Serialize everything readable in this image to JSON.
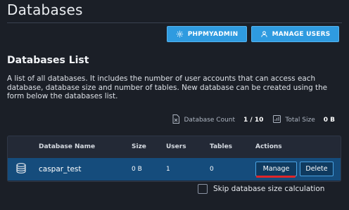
{
  "header": {
    "title": "Databases",
    "buttons": {
      "phpmyadmin_label": "PHPMYADMIN",
      "phpmyadmin_icon": "gear-icon",
      "manage_users_label": "MANAGE USERS",
      "manage_users_icon": "user-icon"
    }
  },
  "section": {
    "title": "Databases List",
    "description": "A list of all databases. It includes the number of user accounts that can access each database, database size and number of tables. New database can be created using the form below the databases list."
  },
  "stats": {
    "database_count_label": "Database Count",
    "database_count_value": "1 / 10",
    "total_size_label": "Total Size",
    "total_size_value": "0 B"
  },
  "table": {
    "columns": [
      "Database Name",
      "Size",
      "Users",
      "Tables",
      "Actions"
    ],
    "rows": [
      {
        "icon": "database-icon",
        "name": "caspar_test",
        "size": "0 B",
        "users": "1",
        "tables": "0",
        "manage_label": "Manage",
        "delete_label": "Delete"
      }
    ]
  },
  "options": {
    "skip_size_label": "Skip database size calculation",
    "skip_size_checked": false
  },
  "colors": {
    "background": "#1b1f27",
    "accent": "#2f9be0",
    "row_selected": "#154c7c",
    "annotation": "#e0262a"
  }
}
